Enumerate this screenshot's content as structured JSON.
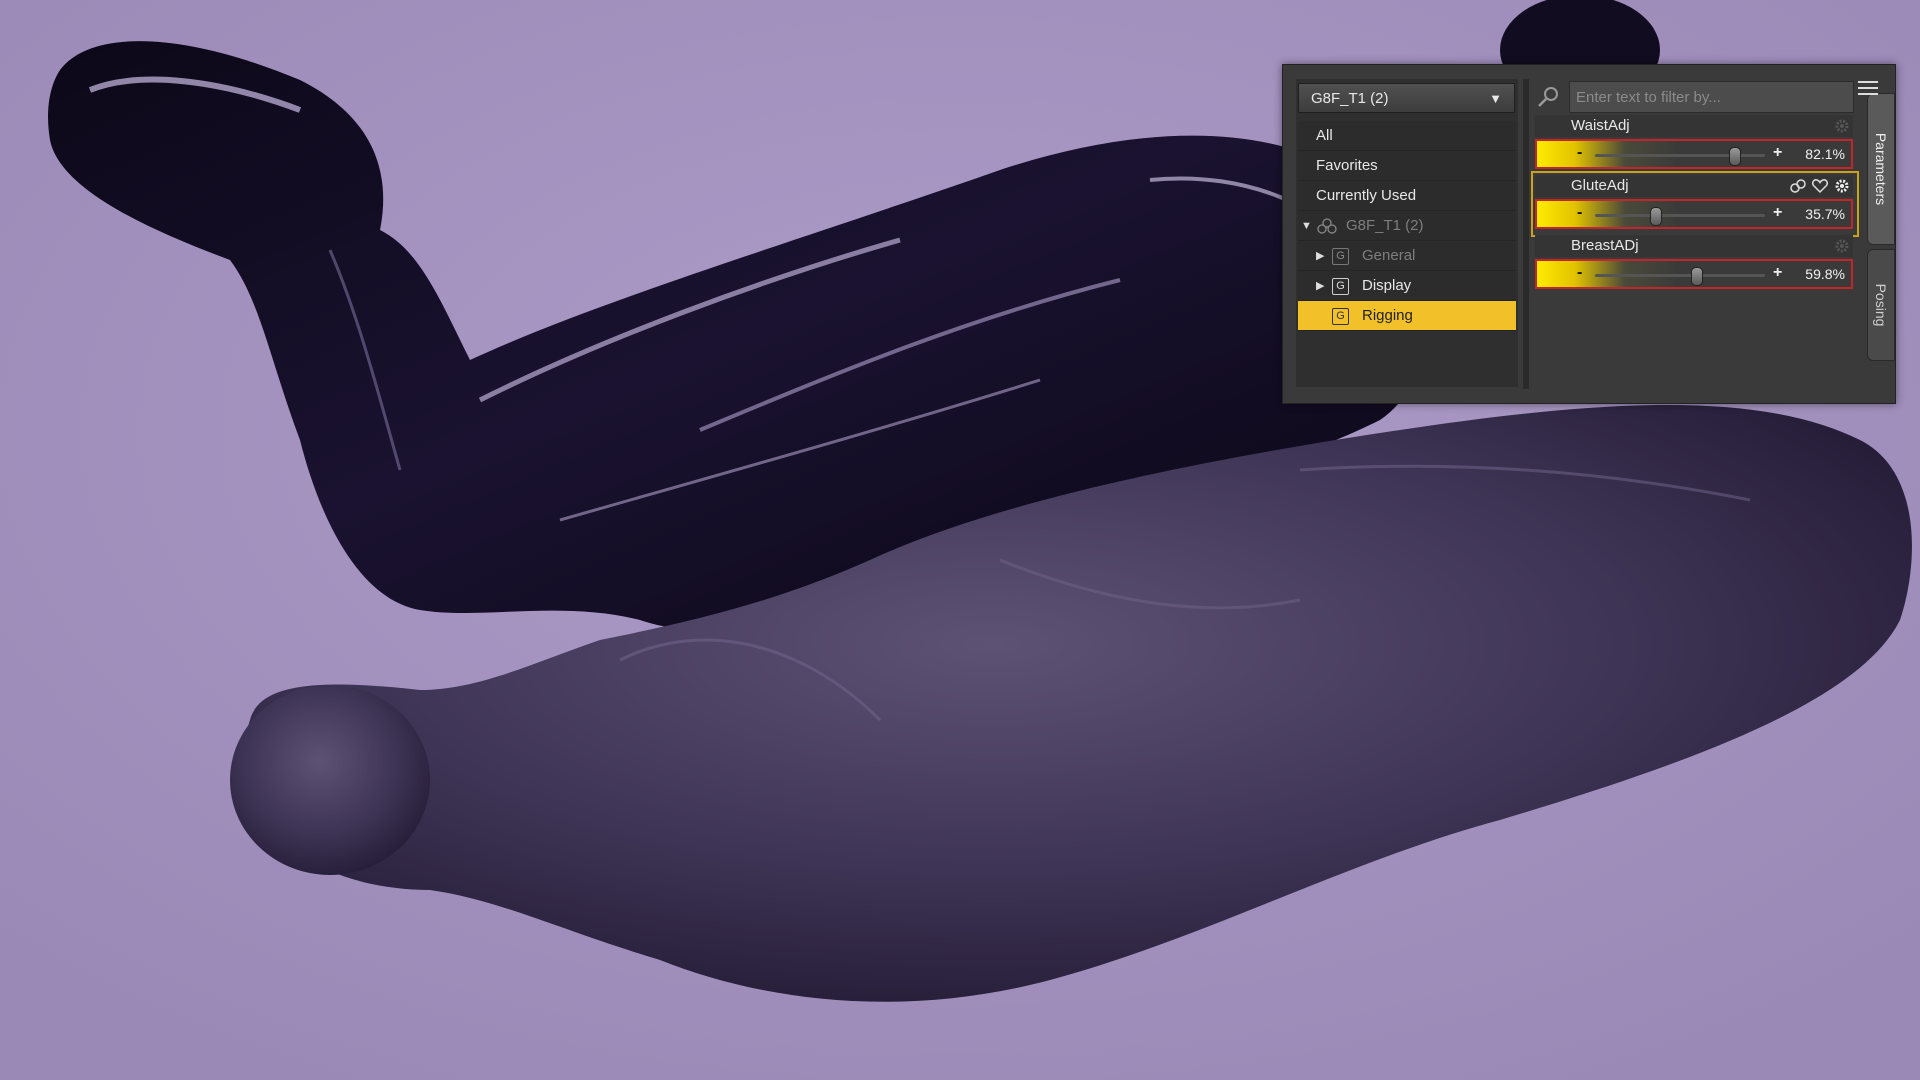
{
  "colors": {
    "background": "#a493c0",
    "accent_selected": "#f2c12a",
    "slider_highlight": "#ffeb00",
    "slider_border": "#c2262b"
  },
  "panel": {
    "node_selector": "G8F_T1 (2)",
    "categories": [
      {
        "label": "All"
      },
      {
        "label": "Favorites"
      },
      {
        "label": "Currently Used"
      },
      {
        "label": "G8F_T1 (2)",
        "icon": "figure-icon",
        "expanded": true
      },
      {
        "label": "General",
        "icon": "group-icon",
        "collapsed": true
      },
      {
        "label": "Display",
        "icon": "group-icon",
        "collapsed": true
      },
      {
        "label": "Rigging",
        "icon": "group-icon",
        "selected": true
      }
    ],
    "filter": {
      "placeholder": "Enter text to filter by..."
    },
    "params": [
      {
        "label": "WaistAdj",
        "value_text": "82.1%",
        "value": 82.1
      },
      {
        "label": "GluteAdj",
        "value_text": "35.7%",
        "value": 35.7
      },
      {
        "label": "BreastADj",
        "value_text": "59.8%",
        "value": 59.8
      }
    ],
    "tabs": [
      "Parameters",
      "Posing"
    ],
    "minus": "-",
    "plus": "+"
  }
}
